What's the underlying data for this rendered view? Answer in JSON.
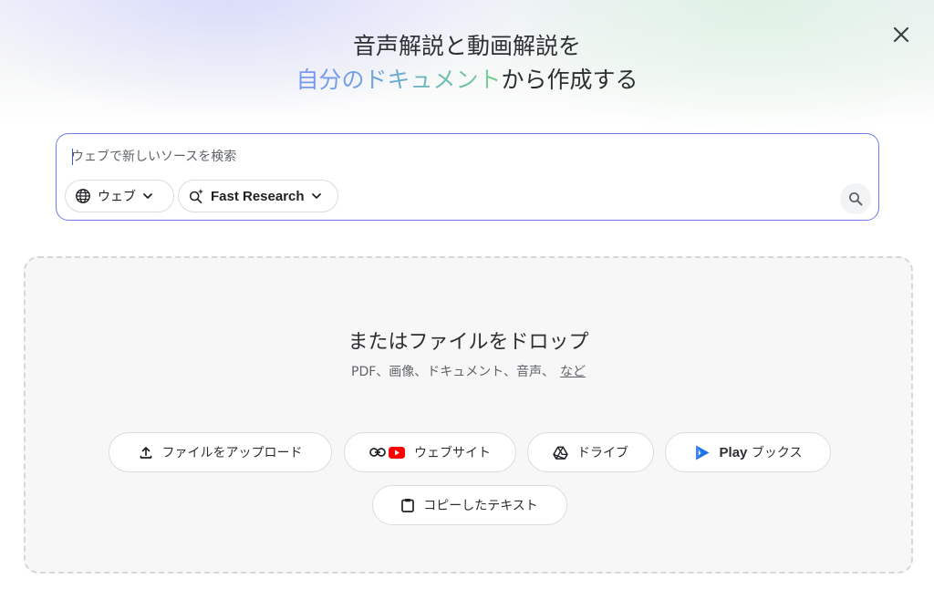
{
  "dialog": {
    "title_line1": "音声解説と動画解説を",
    "title_highlight": "自分のドキュメント",
    "title_rest": "から作成する"
  },
  "search": {
    "placeholder": "ウェブで新しいソースを検索",
    "value": "",
    "source_chip_label": "ウェブ",
    "mode_chip_label": "Fast Research"
  },
  "dropzone": {
    "title": "またはファイルをドロップ",
    "subtitle": "PDF、画像、ドキュメント、音声、",
    "more_link": "など"
  },
  "sources": {
    "upload_label": "ファイルをアップロード",
    "website_label": "ウェブサイト",
    "drive_label": "ドライブ",
    "play_label_strong": "Play",
    "play_label_rest": "ブックス",
    "paste_label": "コピーしたテキスト"
  },
  "colors": {
    "accent_border": "#6f7ce8",
    "gradient_start": "#7b95f2",
    "gradient_end": "#77d48c",
    "youtube_red": "#ff0000"
  },
  "icons": {
    "close": "close-icon",
    "globe": "globe-icon",
    "sparkle_search": "sparkle-search-icon",
    "chevron": "chevron-down-icon",
    "search": "search-icon",
    "upload": "upload-icon",
    "link": "link-icon",
    "youtube": "youtube-icon",
    "drive": "drive-icon",
    "play_books": "play-books-icon",
    "clipboard": "clipboard-icon"
  }
}
